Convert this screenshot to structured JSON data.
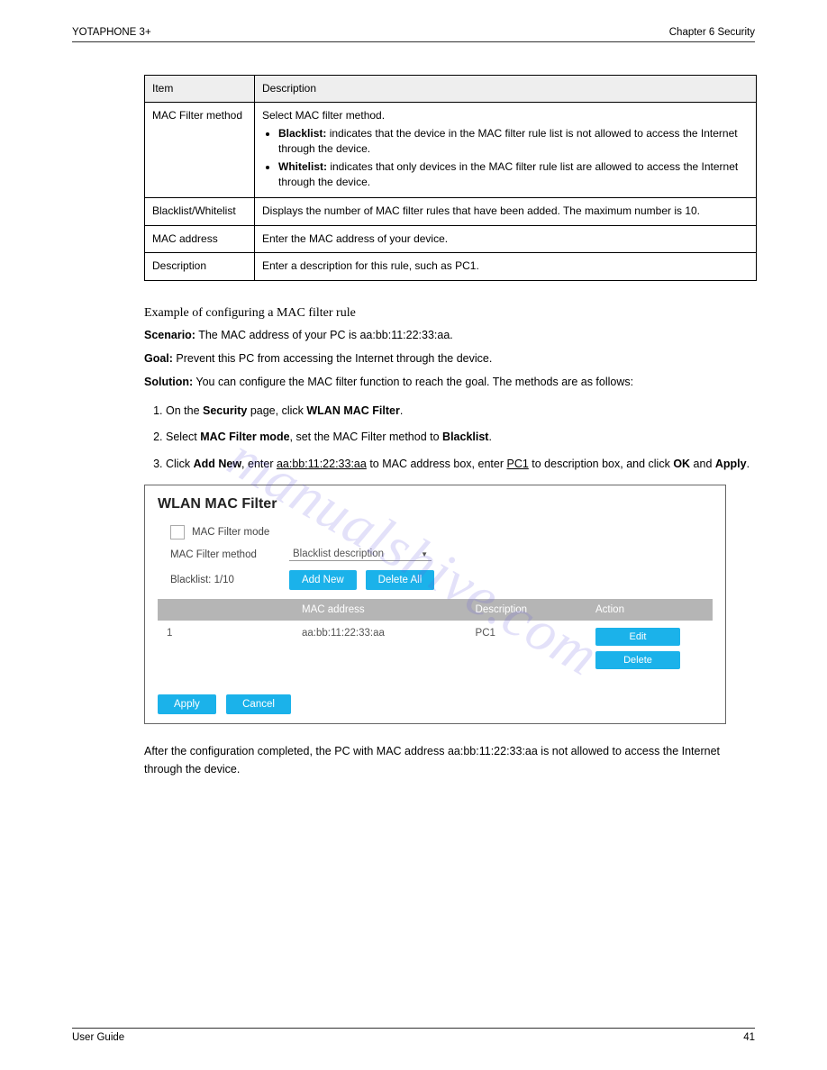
{
  "header": {
    "left": "YOTAPHONE 3+",
    "right": "Chapter 6   Security"
  },
  "table": {
    "col1": "Item",
    "col2": "Description",
    "rows": [
      {
        "label": "MAC Filter method",
        "desc_intro": "Select MAC filter method.",
        "bullets": [
          {
            "b": "Blacklist:",
            "t": " indicates that the device in the MAC filter rule list is not allowed to access the Internet through the device."
          },
          {
            "b": "Whitelist:",
            "t": " indicates that only devices in the MAC filter rule list are allowed to access the Internet through the device."
          }
        ]
      },
      {
        "label": "Blacklist/Whitelist",
        "desc": "Displays the number of MAC filter rules that have been added. The maximum number is 10."
      },
      {
        "label": "MAC address",
        "desc": "Enter the MAC address of your device."
      },
      {
        "label": "Description",
        "desc": "Enter a description for this rule, such as PC1."
      }
    ]
  },
  "example": {
    "title": "Example of configuring a MAC filter rule",
    "scenario_label": "Scenario:",
    "scenario": " The MAC address of your PC is aa:bb:11:22:33:aa.",
    "goal_label": "Goal:",
    "goal": " Prevent this PC from accessing the Internet through the device.",
    "solution_label": "Solution:",
    "solution": " You can configure the MAC filter function to reach the goal. The methods are as follows:",
    "steps": [
      {
        "pre": "On the ",
        "b1": "Security",
        "mid": " page, click ",
        "b2": "WLAN MAC Filter",
        "post": "."
      },
      {
        "full_pre": "Select ",
        "b1": "MAC Filter mode",
        "mid": ", set the MAC Filter method to ",
        "b2": "Blacklist",
        "post": "."
      },
      {
        "pre": "Click ",
        "b1": "Add New",
        "mid": ", enter ",
        "u1": "aa:bb:11:22:33:aa",
        "mid2": " to MAC address box, enter ",
        "u2": "PC1",
        "mid3": " to description box, and click ",
        "b2": "OK",
        "post": " and ",
        "b3": "Apply",
        "end": "."
      }
    ]
  },
  "screenshot": {
    "title": "WLAN MAC Filter",
    "checkbox_label": "MAC Filter mode",
    "method_label": "MAC Filter method",
    "method_value": "Blacklist description",
    "count_label": "Blacklist: 1/10",
    "btn_add": "Add New",
    "btn_del_all": "Delete All",
    "cols": {
      "c1": "",
      "c2": "MAC address",
      "c3": "Description",
      "c4": "Action"
    },
    "row": {
      "idx": "1",
      "mac": "aa:bb:11:22:33:aa",
      "desc": "PC1",
      "edit": "Edit",
      "del": "Delete"
    },
    "apply": "Apply",
    "cancel": "Cancel"
  },
  "ending": "After the configuration completed, the PC with MAC address aa:bb:11:22:33:aa is not allowed to access the Internet through the device.",
  "footer": {
    "left": "User Guide",
    "right": "41"
  },
  "watermark": "manualshive.com"
}
